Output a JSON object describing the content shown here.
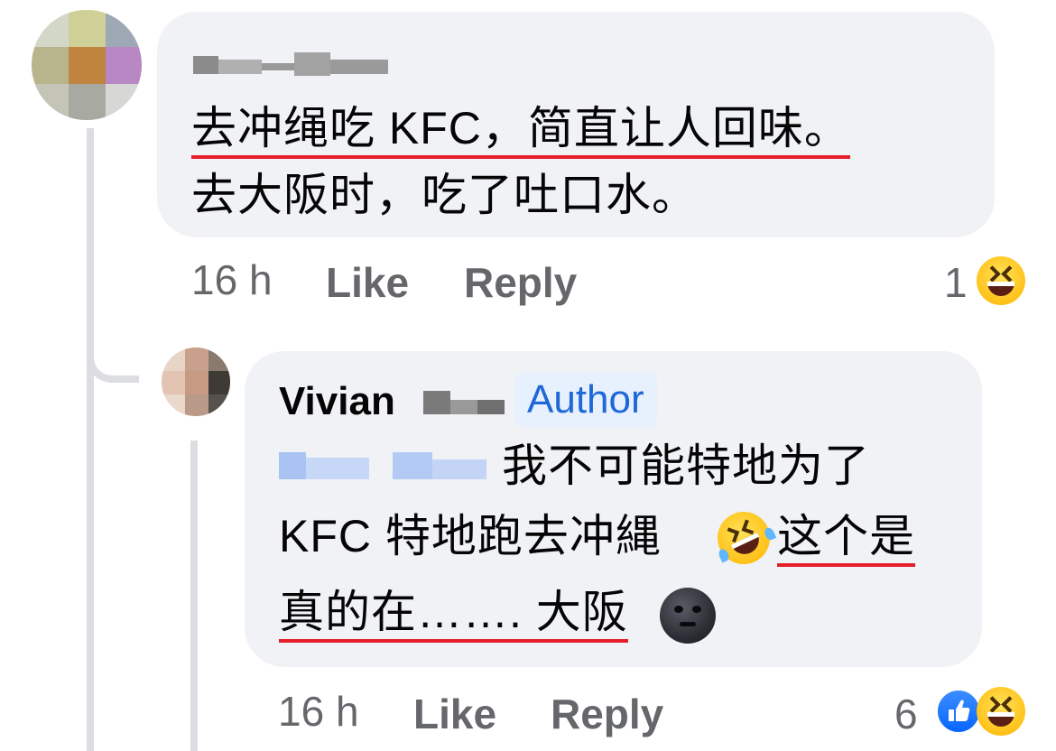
{
  "comments": [
    {
      "author_name": "",
      "text_lines": [
        "去冲绳吃 KFC，简直让人回味。",
        "去大阪时，吃了吐口水。"
      ],
      "time": "16 h",
      "like_label": "Like",
      "reply_label": "Reply",
      "reaction_count": "1",
      "reactions": [
        "laughing-emoji"
      ]
    },
    {
      "author_name": "Vivian",
      "author_badge": "Author",
      "text_lines": [
        "我不可能特地为了",
        "KFC 特地跑去冲縄",
        "这个是",
        "真的在……. 大阪"
      ],
      "inline_emoji": [
        "rofl-emoji",
        "new-moon-face-emoji"
      ],
      "time": "16 h",
      "like_label": "Like",
      "reply_label": "Reply",
      "reaction_count": "6",
      "reactions": [
        "like-reaction",
        "laughing-emoji"
      ]
    }
  ],
  "colors": {
    "bubble": "#f0f2f5",
    "meta_text": "#65676b",
    "badge_bg": "#e7f0fd",
    "badge_text": "#1e68d8",
    "underline": "#e41e2b"
  }
}
